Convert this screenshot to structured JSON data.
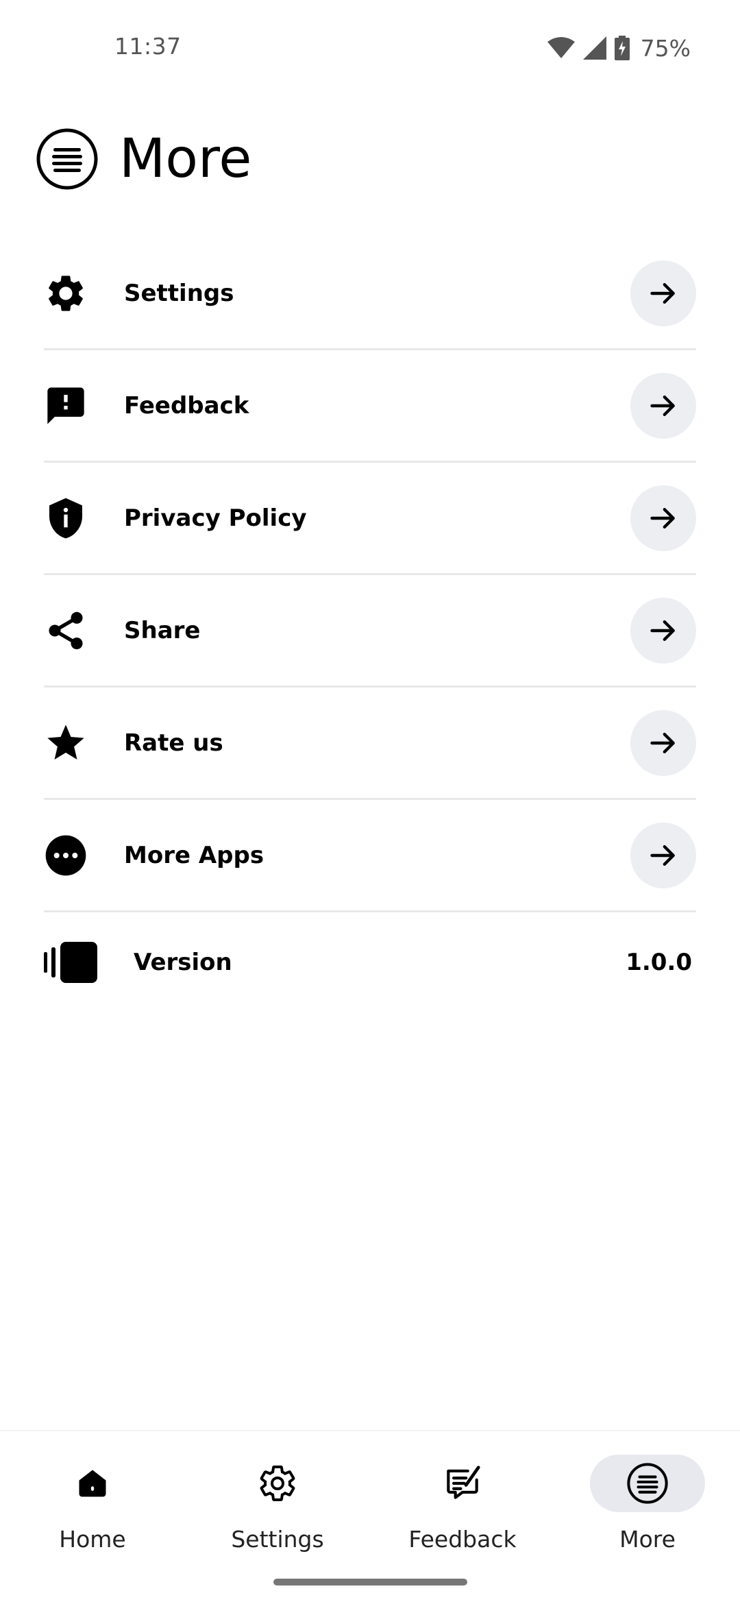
{
  "status_bar": {
    "time": "11:37",
    "battery": "75%"
  },
  "header": {
    "title": "More",
    "icon": "menu-lines-icon"
  },
  "menu": {
    "items": [
      {
        "label": "Settings",
        "icon": "gear-icon"
      },
      {
        "label": "Feedback",
        "icon": "feedback-icon"
      },
      {
        "label": "Privacy Policy",
        "icon": "shield-icon"
      },
      {
        "label": "Share",
        "icon": "share-icon"
      },
      {
        "label": "Rate us",
        "icon": "star-icon"
      },
      {
        "label": "More Apps",
        "icon": "more-dots-icon"
      }
    ],
    "version_label": "Version",
    "version_value": "1.0.0"
  },
  "bottom_nav": {
    "items": [
      {
        "label": "Home",
        "icon": "home-icon"
      },
      {
        "label": "Settings",
        "icon": "gear-icon"
      },
      {
        "label": "Feedback",
        "icon": "feedback-icon"
      },
      {
        "label": "More",
        "icon": "menu-lines-icon",
        "active": true
      }
    ]
  },
  "colors": {
    "arrow_button_bg": "#eceef2",
    "active_nav_pill": "#e7e9ee",
    "divider": "#e8e8e8"
  }
}
